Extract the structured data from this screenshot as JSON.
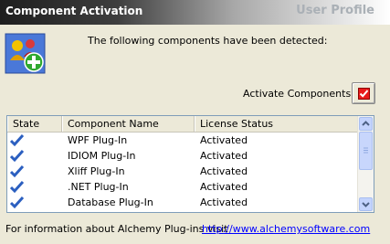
{
  "window": {
    "title": "Component Activation",
    "subtitle": "User Profile"
  },
  "intro": "The following components have been detected:",
  "activate": {
    "label": "Activate Components"
  },
  "grid": {
    "columns": [
      "State",
      "Component Name",
      "License Status"
    ],
    "rows": [
      {
        "checked": true,
        "name": "WPF Plug-In",
        "status": "Activated"
      },
      {
        "checked": true,
        "name": "IDIOM Plug-In",
        "status": "Activated"
      },
      {
        "checked": true,
        "name": "Xliff Plug-In",
        "status": "Activated"
      },
      {
        "checked": true,
        "name": ".NET Plug-In",
        "status": "Activated"
      },
      {
        "checked": true,
        "name": "Database Plug-In",
        "status": "Activated"
      }
    ]
  },
  "footer": {
    "text": "For information about Alchemy Plug-ins visit",
    "link": "http://www.alchemysoftware.com"
  },
  "colors": {
    "accent": "#1e1e1e",
    "link": "#0000ff",
    "checkbox": "#e81a1a"
  }
}
